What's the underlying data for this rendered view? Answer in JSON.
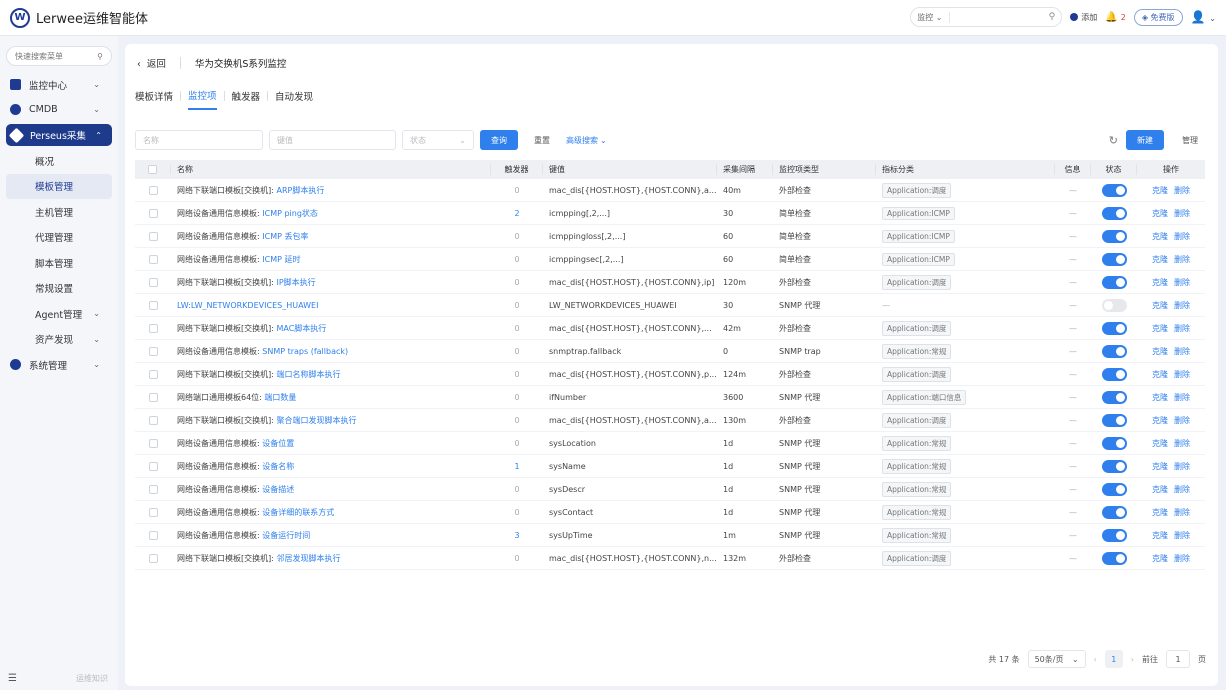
{
  "app": {
    "title": "Lerwee运维智能体",
    "logo_letter": "W"
  },
  "topbar": {
    "search_type": "监控",
    "add_label": "添加",
    "alert_count": "2",
    "free_label": "免费版"
  },
  "sidebar": {
    "search_placeholder": "快速搜索菜单",
    "items": [
      {
        "label": "监控中心",
        "icon": "monitor-icon"
      },
      {
        "label": "CMDB",
        "icon": "cube-icon"
      },
      {
        "label": "Perseus采集",
        "icon": "collect-icon",
        "active": true
      }
    ],
    "sub_items": [
      "概况",
      "模板管理",
      "主机管理",
      "代理管理",
      "脚本管理",
      "常规设置",
      "Agent管理",
      "资产发现"
    ],
    "system_label": "系统管理",
    "bottom_label": "运维知识"
  },
  "page": {
    "back_label": "返回",
    "title": "华为交换机S系列监控",
    "tabs": [
      "模板详情",
      "监控项",
      "触发器",
      "自动发现"
    ],
    "active_tab": 1
  },
  "filters": {
    "name_placeholder": "名称",
    "key_placeholder": "键值",
    "status_placeholder": "状态",
    "query_label": "查询",
    "reset_label": "重置",
    "advanced_label": "高级搜索",
    "new_label": "新建",
    "manage_label": "管理"
  },
  "table": {
    "headers": [
      "名称",
      "触发器",
      "键值",
      "采集间隔",
      "监控项类型",
      "指标分类",
      "信息",
      "状态",
      "操作"
    ],
    "edit_label": "克隆",
    "delete_label": "删除",
    "rows": [
      {
        "prefix": "网络下联端口模板[交换机]: ",
        "name": "ARP脚本执行",
        "triggers": "0",
        "key": "mac_dis[{HOST.HOST},{HOST.CONN},a...",
        "interval": "40m",
        "type": "外部检查",
        "tag": "Application:调度",
        "info": "—",
        "on": true
      },
      {
        "prefix": "网络设备通用信息模板: ",
        "name": "ICMP ping状态",
        "triggers": "2",
        "key": "icmpping[,2,...]",
        "interval": "30",
        "type": "简单检查",
        "tag": "Application:ICMP",
        "info": "—",
        "on": true
      },
      {
        "prefix": "网络设备通用信息模板: ",
        "name": "ICMP 丢包率",
        "triggers": "0",
        "key": "icmppingloss[,2,...]",
        "interval": "60",
        "type": "简单检查",
        "tag": "Application:ICMP",
        "info": "—",
        "on": true
      },
      {
        "prefix": "网络设备通用信息模板: ",
        "name": "ICMP 延时",
        "triggers": "0",
        "key": "icmppingsec[,2,...]",
        "interval": "60",
        "type": "简单检查",
        "tag": "Application:ICMP",
        "info": "—",
        "on": true
      },
      {
        "prefix": "网络下联端口模板[交换机]: ",
        "name": "IP脚本执行",
        "triggers": "0",
        "key": "mac_dis[{HOST.HOST},{HOST.CONN},ip]",
        "interval": "120m",
        "type": "外部检查",
        "tag": "Application:调度",
        "info": "—",
        "on": true
      },
      {
        "prefix": "",
        "name": "LW:LW_NETWORKDEVICES_HUAWEI",
        "triggers": "0",
        "key": "LW_NETWORKDEVICES_HUAWEI",
        "interval": "30",
        "type": "SNMP 代理",
        "tag": "",
        "info": "—",
        "on": false
      },
      {
        "prefix": "网络下联端口模板[交换机]: ",
        "name": "MAC脚本执行",
        "triggers": "0",
        "key": "mac_dis[{HOST.HOST},{HOST.CONN},...",
        "interval": "42m",
        "type": "外部检查",
        "tag": "Application:调度",
        "info": "—",
        "on": true
      },
      {
        "prefix": "网络设备通用信息模板: ",
        "name": "SNMP traps (fallback)",
        "triggers": "0",
        "key": "snmptrap.fallback",
        "interval": "0",
        "type": "SNMP trap",
        "tag": "Application:常规",
        "info": "—",
        "on": true
      },
      {
        "prefix": "网络下联端口模板[交换机]: ",
        "name": "端口名称脚本执行",
        "triggers": "0",
        "key": "mac_dis[{HOST.HOST},{HOST.CONN},p...",
        "interval": "124m",
        "type": "外部检查",
        "tag": "Application:调度",
        "info": "—",
        "on": true
      },
      {
        "prefix": "网络端口通用模板64位: ",
        "name": "端口数量",
        "triggers": "0",
        "key": "ifNumber",
        "interval": "3600",
        "type": "SNMP 代理",
        "tag": "Application:端口信息",
        "info": "—",
        "on": true
      },
      {
        "prefix": "网络下联端口模板[交换机]: ",
        "name": "聚合端口发现脚本执行",
        "triggers": "0",
        "key": "mac_dis[{HOST.HOST},{HOST.CONN},a...",
        "interval": "130m",
        "type": "外部检查",
        "tag": "Application:调度",
        "info": "—",
        "on": true
      },
      {
        "prefix": "网络设备通用信息模板: ",
        "name": "设备位置",
        "triggers": "0",
        "key": "sysLocation",
        "interval": "1d",
        "type": "SNMP 代理",
        "tag": "Application:常规",
        "info": "—",
        "on": true
      },
      {
        "prefix": "网络设备通用信息模板: ",
        "name": "设备名称",
        "triggers": "1",
        "key": "sysName",
        "interval": "1d",
        "type": "SNMP 代理",
        "tag": "Application:常规",
        "info": "—",
        "on": true
      },
      {
        "prefix": "网络设备通用信息模板: ",
        "name": "设备描述",
        "triggers": "0",
        "key": "sysDescr",
        "interval": "1d",
        "type": "SNMP 代理",
        "tag": "Application:常规",
        "info": "—",
        "on": true
      },
      {
        "prefix": "网络设备通用信息模板: ",
        "name": "设备详细的联系方式",
        "triggers": "0",
        "key": "sysContact",
        "interval": "1d",
        "type": "SNMP 代理",
        "tag": "Application:常规",
        "info": "—",
        "on": true
      },
      {
        "prefix": "网络设备通用信息模板: ",
        "name": "设备运行时间",
        "triggers": "3",
        "key": "sysUpTime",
        "interval": "1m",
        "type": "SNMP 代理",
        "tag": "Application:常规",
        "info": "—",
        "on": true
      },
      {
        "prefix": "网络下联端口模板[交换机]: ",
        "name": "邻居发现脚本执行",
        "triggers": "0",
        "key": "mac_dis[{HOST.HOST},{HOST.CONN},n...",
        "interval": "132m",
        "type": "外部检查",
        "tag": "Application:调度",
        "info": "—",
        "on": true
      }
    ]
  },
  "pager": {
    "total": "共 17 条",
    "page_size": "50条/页",
    "current": "1",
    "goto_label": "前往",
    "goto_value": "1",
    "page_unit": "页"
  }
}
